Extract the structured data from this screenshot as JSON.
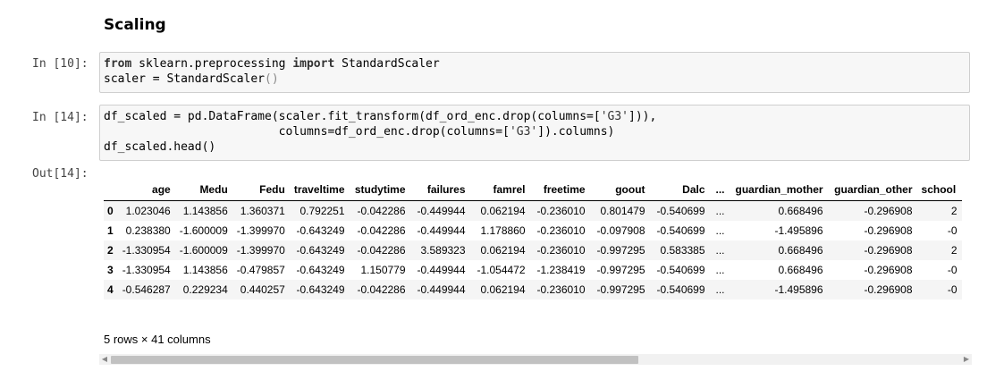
{
  "section_title": "Scaling",
  "cells": [
    {
      "prompt": "In [10]:",
      "lines": [
        [
          [
            "kw",
            "from"
          ],
          [
            "t",
            " sklearn.preprocessing "
          ],
          [
            "kw",
            "import"
          ],
          [
            "t",
            " StandardScaler"
          ]
        ],
        [
          [
            "t",
            "scaler = StandardScaler"
          ],
          [
            "p",
            "()"
          ]
        ]
      ]
    },
    {
      "prompt": "In [14]:",
      "lines": [
        [
          [
            "t",
            "df_scaled = pd.DataFrame(scaler.fit_transform(df_ord_enc.drop(columns=["
          ],
          [
            "s",
            "'G3'"
          ],
          [
            "t",
            "])),"
          ]
        ],
        [
          [
            "t",
            "                         columns=df_ord_enc.drop(columns=["
          ],
          [
            "s",
            "'G3'"
          ],
          [
            "t",
            "]).columns)"
          ]
        ],
        [
          [
            "t",
            "df_scaled.head()"
          ]
        ]
      ]
    }
  ],
  "output_prompt": "Out[14]:",
  "table": {
    "columns": [
      "age",
      "Medu",
      "Fedu",
      "traveltime",
      "studytime",
      "failures",
      "famrel",
      "freetime",
      "goout",
      "Dalc",
      "...",
      "guardian_mother",
      "guardian_other",
      "school"
    ],
    "rows": [
      {
        "index": "0",
        "values": [
          "1.023046",
          "1.143856",
          "1.360371",
          "0.792251",
          "-0.042286",
          "-0.449944",
          "0.062194",
          "-0.236010",
          "0.801479",
          "-0.540699",
          "...",
          "0.668496",
          "-0.296908",
          "2"
        ]
      },
      {
        "index": "1",
        "values": [
          "0.238380",
          "-1.600009",
          "-1.399970",
          "-0.643249",
          "-0.042286",
          "-0.449944",
          "1.178860",
          "-0.236010",
          "-0.097908",
          "-0.540699",
          "...",
          "-1.495896",
          "-0.296908",
          "-0"
        ]
      },
      {
        "index": "2",
        "values": [
          "-1.330954",
          "-1.600009",
          "-1.399970",
          "-0.643249",
          "-0.042286",
          "3.589323",
          "0.062194",
          "-0.236010",
          "-0.997295",
          "0.583385",
          "...",
          "0.668496",
          "-0.296908",
          "2"
        ]
      },
      {
        "index": "3",
        "values": [
          "-1.330954",
          "1.143856",
          "-0.479857",
          "-0.643249",
          "1.150779",
          "-0.449944",
          "-1.054472",
          "-1.238419",
          "-0.997295",
          "-0.540699",
          "...",
          "0.668496",
          "-0.296908",
          "-0"
        ]
      },
      {
        "index": "4",
        "values": [
          "-0.546287",
          "0.229234",
          "0.440257",
          "-0.643249",
          "-0.042286",
          "-0.449944",
          "0.062194",
          "-0.236010",
          "-0.997295",
          "-0.540699",
          "...",
          "-1.495896",
          "-0.296908",
          "-0"
        ]
      }
    ]
  },
  "summary": "5 rows × 41 columns",
  "scroll": {
    "left_arrow": "◀",
    "right_arrow": "▶",
    "position": 0.6
  }
}
